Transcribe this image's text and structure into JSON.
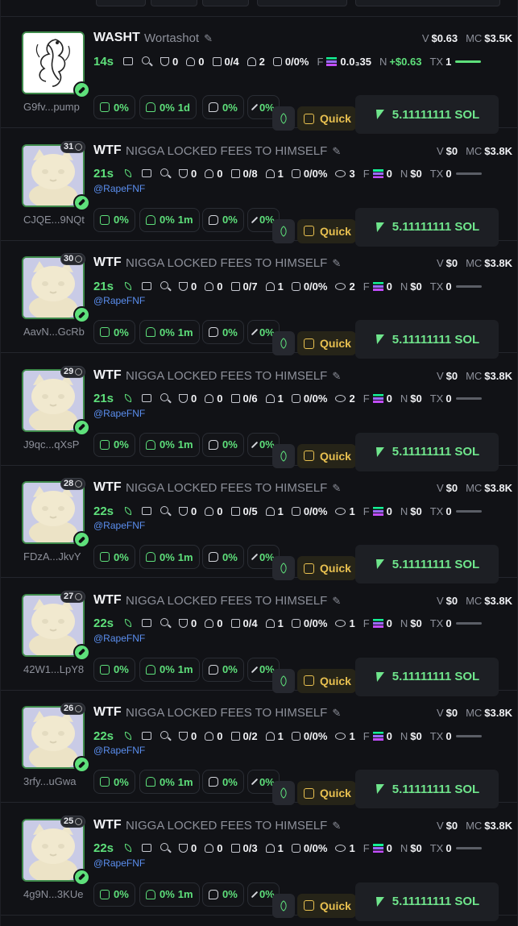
{
  "top_partial": {
    "ca": "...pump"
  },
  "tokens": [
    {
      "ticker": "WASHT",
      "name": "Wortashot",
      "rank": "",
      "age": "14s",
      "ca": "G9fv...pump",
      "handle": "",
      "holders_pct": "0%",
      "dev_pct": "0%",
      "dev_age": "1d",
      "snipers_pct": "0%",
      "bundle_pct": "0%",
      "top10": "0",
      "dev_holders": "0",
      "kols": "0/4",
      "users": "2",
      "bots": "0/0%",
      "watchers": "",
      "volume": "$0.63",
      "mcap": "$3.5K",
      "fees": "0.0₃35",
      "net": "+$0.63",
      "tx": "1",
      "quick_label": "Quick",
      "buy_label": "5.11111111 SOL"
    },
    {
      "ticker": "WTF",
      "name": "NIGGA LOCKED FEES TO HIMSELF",
      "rank": "31",
      "age": "21s",
      "ca": "CJQE...9NQt",
      "handle": "@RapeFNF",
      "holders_pct": "0%",
      "dev_pct": "0%",
      "dev_age": "1m",
      "snipers_pct": "0%",
      "bundle_pct": "0%",
      "top10": "0",
      "dev_holders": "0",
      "kols": "0/8",
      "users": "1",
      "bots": "0/0%",
      "watchers": "3",
      "volume": "$0",
      "mcap": "$3.8K",
      "fees": "0",
      "net": "$0",
      "tx": "0",
      "quick_label": "Quick",
      "buy_label": "5.11111111 SOL"
    },
    {
      "ticker": "WTF",
      "name": "NIGGA LOCKED FEES TO HIMSELF",
      "rank": "30",
      "age": "21s",
      "ca": "AavN...GcRb",
      "handle": "@RapeFNF",
      "holders_pct": "0%",
      "dev_pct": "0%",
      "dev_age": "1m",
      "snipers_pct": "0%",
      "bundle_pct": "0%",
      "top10": "0",
      "dev_holders": "0",
      "kols": "0/7",
      "users": "1",
      "bots": "0/0%",
      "watchers": "2",
      "volume": "$0",
      "mcap": "$3.8K",
      "fees": "0",
      "net": "$0",
      "tx": "0",
      "quick_label": "Quick",
      "buy_label": "5.11111111 SOL"
    },
    {
      "ticker": "WTF",
      "name": "NIGGA LOCKED FEES TO HIMSELF",
      "rank": "29",
      "age": "21s",
      "ca": "J9qc...qXsP",
      "handle": "@RapeFNF",
      "holders_pct": "0%",
      "dev_pct": "0%",
      "dev_age": "1m",
      "snipers_pct": "0%",
      "bundle_pct": "0%",
      "top10": "0",
      "dev_holders": "0",
      "kols": "0/6",
      "users": "1",
      "bots": "0/0%",
      "watchers": "2",
      "volume": "$0",
      "mcap": "$3.8K",
      "fees": "0",
      "net": "$0",
      "tx": "0",
      "quick_label": "Quick",
      "buy_label": "5.11111111 SOL"
    },
    {
      "ticker": "WTF",
      "name": "NIGGA LOCKED FEES TO HIMSELF",
      "rank": "28",
      "age": "22s",
      "ca": "FDzA...JkvY",
      "handle": "@RapeFNF",
      "holders_pct": "0%",
      "dev_pct": "0%",
      "dev_age": "1m",
      "snipers_pct": "0%",
      "bundle_pct": "0%",
      "top10": "0",
      "dev_holders": "0",
      "kols": "0/5",
      "users": "1",
      "bots": "0/0%",
      "watchers": "1",
      "volume": "$0",
      "mcap": "$3.8K",
      "fees": "0",
      "net": "$0",
      "tx": "0",
      "quick_label": "Quick",
      "buy_label": "5.11111111 SOL"
    },
    {
      "ticker": "WTF",
      "name": "NIGGA LOCKED FEES TO HIMSELF",
      "rank": "27",
      "age": "22s",
      "ca": "42W1...LpY8",
      "handle": "@RapeFNF",
      "holders_pct": "0%",
      "dev_pct": "0%",
      "dev_age": "1m",
      "snipers_pct": "0%",
      "bundle_pct": "0%",
      "top10": "0",
      "dev_holders": "0",
      "kols": "0/4",
      "users": "1",
      "bots": "0/0%",
      "watchers": "1",
      "volume": "$0",
      "mcap": "$3.8K",
      "fees": "0",
      "net": "$0",
      "tx": "0",
      "quick_label": "Quick",
      "buy_label": "5.11111111 SOL"
    },
    {
      "ticker": "WTF",
      "name": "NIGGA LOCKED FEES TO HIMSELF",
      "rank": "26",
      "age": "22s",
      "ca": "3rfy...uGwa",
      "handle": "@RapeFNF",
      "holders_pct": "0%",
      "dev_pct": "0%",
      "dev_age": "1m",
      "snipers_pct": "0%",
      "bundle_pct": "0%",
      "top10": "0",
      "dev_holders": "0",
      "kols": "0/2",
      "users": "1",
      "bots": "0/0%",
      "watchers": "1",
      "volume": "$0",
      "mcap": "$3.8K",
      "fees": "0",
      "net": "$0",
      "tx": "0",
      "quick_label": "Quick",
      "buy_label": "5.11111111 SOL"
    },
    {
      "ticker": "WTF",
      "name": "NIGGA LOCKED FEES TO HIMSELF",
      "rank": "25",
      "age": "22s",
      "ca": "4g9N...3KUe",
      "handle": "@RapeFNF",
      "holders_pct": "0%",
      "dev_pct": "0%",
      "dev_age": "1m",
      "snipers_pct": "0%",
      "bundle_pct": "0%",
      "top10": "0",
      "dev_holders": "0",
      "kols": "0/3",
      "users": "1",
      "bots": "0/0%",
      "watchers": "1",
      "volume": "$0",
      "mcap": "$3.8K",
      "fees": "0",
      "net": "$0",
      "tx": "0",
      "quick_label": "Quick",
      "buy_label": "5.11111111 SOL"
    }
  ],
  "labels": {
    "v": "V",
    "mc": "MC",
    "f": "F",
    "n": "N",
    "tx": "TX"
  },
  "colors": {
    "accent_green": "#5ee07b",
    "quick_yellow": "#e8c050",
    "handle_blue": "#5b8ff0",
    "bg": "#111216"
  }
}
